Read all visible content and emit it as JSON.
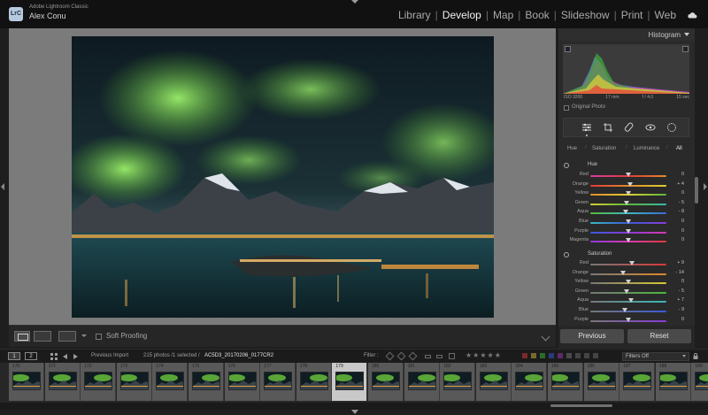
{
  "app": {
    "logo_text": "LrC",
    "product_name": "Adobe Lightroom Classic",
    "user_name": "Alex Conu"
  },
  "modules": [
    {
      "label": "Library",
      "active": false
    },
    {
      "label": "Develop",
      "active": true
    },
    {
      "label": "Map",
      "active": false
    },
    {
      "label": "Book",
      "active": false
    },
    {
      "label": "Slideshow",
      "active": false
    },
    {
      "label": "Print",
      "active": false
    },
    {
      "label": "Web",
      "active": false
    }
  ],
  "histogram": {
    "title": "Histogram",
    "exif": [
      "ISO 3200",
      "17 mm",
      "f / 4.0",
      "15 sec"
    ],
    "original_photo_label": "Original Photo"
  },
  "hsl": {
    "tabs": [
      "Hue",
      "Saturation",
      "Luminance",
      "All"
    ],
    "active_tab": "All",
    "hue_title": "Hue",
    "saturation_title": "Saturation",
    "hue_rows": [
      {
        "label": "Red",
        "value": "0",
        "level": 0
      },
      {
        "label": "Orange",
        "value": "+ 4",
        "level": 4
      },
      {
        "label": "Yellow",
        "value": "0",
        "level": 0
      },
      {
        "label": "Green",
        "value": "- 5",
        "level": -5
      },
      {
        "label": "Aqua",
        "value": "- 8",
        "level": -8
      },
      {
        "label": "Blue",
        "value": "0",
        "level": 0
      },
      {
        "label": "Purple",
        "value": "0",
        "level": 0
      },
      {
        "label": "Magenta",
        "value": "0",
        "level": 0
      }
    ],
    "saturation_rows": [
      {
        "label": "Red",
        "value": "+ 9",
        "level": 9
      },
      {
        "label": "Orange",
        "value": "- 14",
        "level": -14
      },
      {
        "label": "Yellow",
        "value": "0",
        "level": 0
      },
      {
        "label": "Green",
        "value": "- 5",
        "level": -5
      },
      {
        "label": "Aqua",
        "value": "+ 7",
        "level": 7
      },
      {
        "label": "Blue",
        "value": "- 9",
        "level": -9
      },
      {
        "label": "Purple",
        "value": "0",
        "level": 0
      }
    ]
  },
  "buttons": {
    "previous": "Previous",
    "reset": "Reset"
  },
  "toolbar": {
    "soft_proofing": "Soft Proofing"
  },
  "filmstrip": {
    "monitor_1": "1",
    "monitor_2": "2",
    "source": "Previous Import",
    "summary": "215 photos /1 selected /",
    "filename": "AC5D3_20170206_0177CR2",
    "filter_label": "Filter :",
    "filters_off": "Filters Off",
    "stars": "★★★★★",
    "frames": [
      "170",
      "171",
      "172",
      "173",
      "174",
      "175",
      "176",
      "177",
      "178",
      "179",
      "180",
      "181",
      "182",
      "183",
      "184",
      "185",
      "186",
      "187",
      "188",
      "189"
    ],
    "selected_frame": "179"
  },
  "colors": {
    "aurora": "#7ed64a",
    "sky": "#0e1a22",
    "accent_active": "#f0f0f0",
    "panel": "#2a2a2a"
  }
}
